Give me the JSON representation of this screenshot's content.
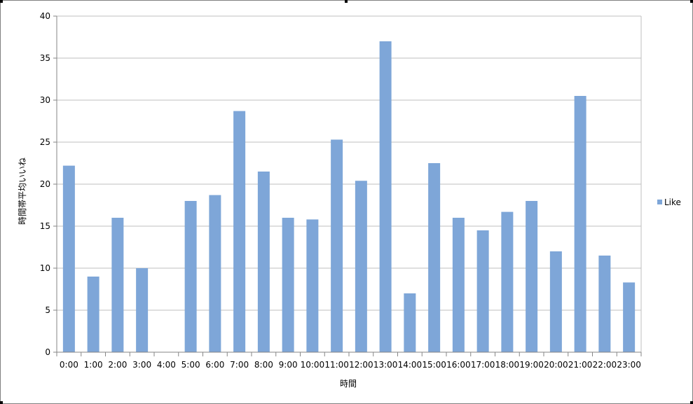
{
  "chart_data": {
    "type": "bar",
    "categories": [
      "0:00",
      "1:00",
      "2:00",
      "3:00",
      "4:00",
      "5:00",
      "6:00",
      "7:00",
      "8:00",
      "9:00",
      "10:00",
      "11:00",
      "12:00",
      "13:00",
      "14:00",
      "15:00",
      "16:00",
      "17:00",
      "18:00",
      "19:00",
      "20:00",
      "21:00",
      "22:00",
      "23:00"
    ],
    "series": [
      {
        "name": "Like",
        "values": [
          22.2,
          9,
          16,
          10,
          0,
          18,
          18.7,
          28.7,
          21.5,
          16,
          15.8,
          25.3,
          20.4,
          37,
          7,
          22.5,
          16,
          14.5,
          16.7,
          18,
          12,
          30.5,
          11.5,
          8.3
        ]
      }
    ],
    "title": "",
    "xlabel": "時間",
    "ylabel": "時間帯平均いいね",
    "ylim": [
      0,
      40
    ],
    "yticks": [
      0,
      5,
      10,
      15,
      20,
      25,
      30,
      35,
      40
    ],
    "grid": true,
    "legend_position": "right",
    "colors": {
      "bar": "#7ea6d8",
      "grid": "#bfbfbf",
      "axis": "#868686"
    }
  }
}
